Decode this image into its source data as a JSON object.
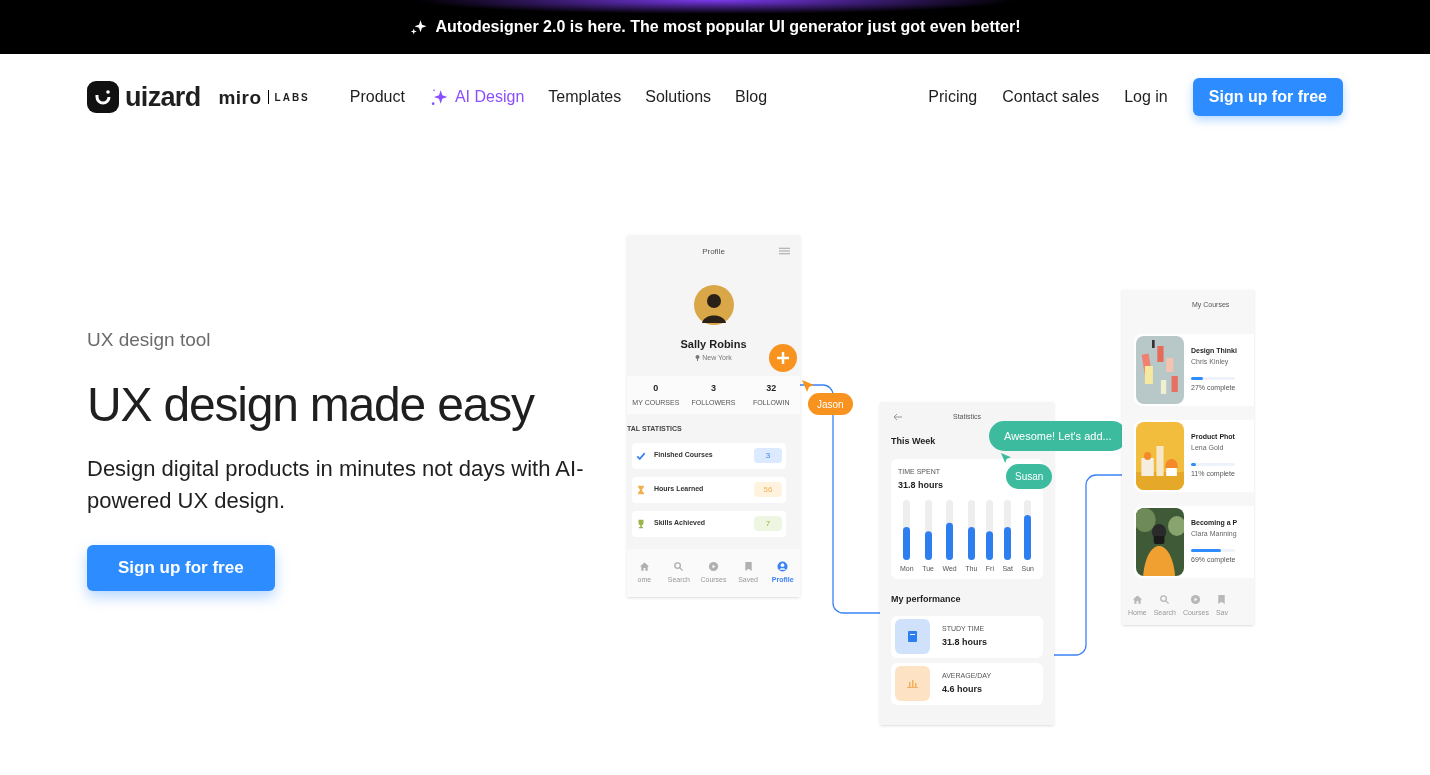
{
  "banner": {
    "text": "Autodesigner 2.0 is here. The most popular UI generator just got even better!"
  },
  "logo": {
    "brand": "uizard",
    "partner": "miro",
    "partner_tag": "LABS"
  },
  "nav": {
    "items": [
      {
        "label": "Product",
        "kind": "plain"
      },
      {
        "label": "AI Design",
        "kind": "ai"
      },
      {
        "label": "Templates",
        "kind": "plain"
      },
      {
        "label": "Solutions",
        "kind": "plain"
      },
      {
        "label": "Blog",
        "kind": "plain"
      }
    ],
    "right": [
      "Pricing",
      "Contact sales",
      "Log in"
    ],
    "cta": "Sign up for free"
  },
  "hero": {
    "eyebrow": "UX design tool",
    "title": "UX design made easy",
    "subtitle": "Design digital products in minutes not days with AI-powered UX design.",
    "cta": "Sign up for free"
  },
  "profile_screen": {
    "title": "Profile",
    "name": "Sally Robins",
    "location": "New York",
    "counts": [
      {
        "value": "0",
        "label": "MY COURSES"
      },
      {
        "value": "3",
        "label": "FOLLOWERS"
      },
      {
        "value": "32",
        "label": "FOLLOWIN"
      }
    ],
    "section": "TAL STATISTICS",
    "stats": [
      {
        "kind": "check",
        "label": "Finished Courses",
        "value": "3"
      },
      {
        "kind": "hourglass",
        "label": "Hours Learned",
        "value": "56"
      },
      {
        "kind": "trophy",
        "label": "Skills Achieved",
        "value": "7"
      }
    ],
    "tabs": [
      {
        "kind": "home",
        "label": "ome",
        "selected": false
      },
      {
        "kind": "search",
        "label": "Search",
        "selected": false
      },
      {
        "kind": "play",
        "label": "Courses",
        "selected": false
      },
      {
        "kind": "bookmark",
        "label": "Saved",
        "selected": false
      },
      {
        "kind": "user",
        "label": "Profile",
        "selected": true
      }
    ]
  },
  "stats_screen": {
    "title": "Statistics",
    "week": "This Week",
    "time_label": "TIME SPENT",
    "time_value": "31.8 hours",
    "days": [
      "Mon",
      "Tue",
      "Wed",
      "Thu",
      "Fri",
      "Sat",
      "Sun"
    ],
    "performance_title": "My performance",
    "performance": [
      {
        "kind": "study",
        "label": "STUDY TIME",
        "value": "31.8 hours"
      },
      {
        "kind": "average",
        "label": "AVERAGE/DAY",
        "value": "4.6 hours"
      }
    ]
  },
  "courses_screen": {
    "title": "My Courses",
    "courses": [
      {
        "title": "Design Thinki",
        "author": "Chris Kinley",
        "level": 0.27,
        "progress": "27% complete"
      },
      {
        "title": "Product Phot",
        "author": "Lena Gold",
        "level": 0.11,
        "progress": "11% complete"
      },
      {
        "title": "Becoming a P",
        "author": "Clara Manning",
        "level": 0.69,
        "progress": "69% complete"
      }
    ],
    "tabs": [
      {
        "kind": "home",
        "label": "Home"
      },
      {
        "kind": "search",
        "label": "Search"
      },
      {
        "kind": "play",
        "label": "Courses"
      },
      {
        "kind": "bookmark",
        "label": "Sav"
      }
    ]
  },
  "collaborators": [
    {
      "name": "Jason",
      "color": "#f7931e"
    },
    {
      "name": "Susan",
      "color": "#3dbb9f",
      "message": "Awesome! Let's add..."
    }
  ]
}
